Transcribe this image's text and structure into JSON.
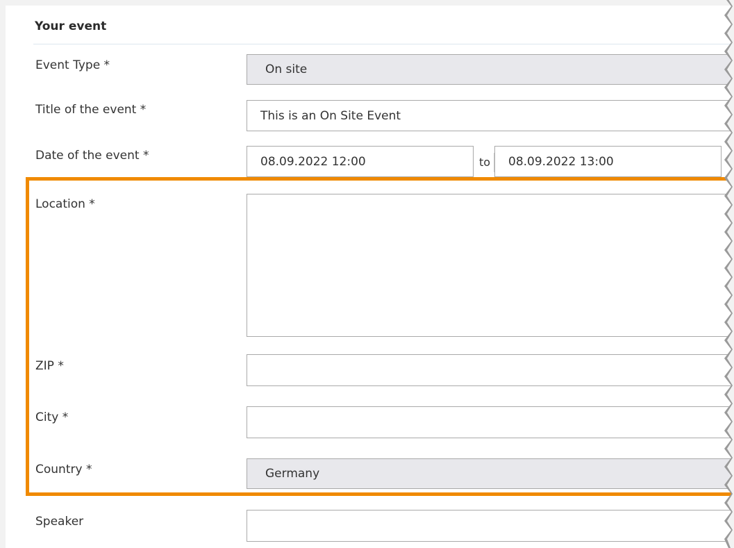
{
  "section": {
    "title": "Your event"
  },
  "form": {
    "event_type": {
      "label": "Event Type *",
      "value": "On site"
    },
    "title": {
      "label": "Title of the event *",
      "value": "This is an On Site Event"
    },
    "date": {
      "label": "Date of the event *",
      "start": "08.09.2022 12:00",
      "separator": "to",
      "end": "08.09.2022 13:00"
    },
    "location": {
      "label": "Location *",
      "value": ""
    },
    "zip": {
      "label": "ZIP *",
      "value": ""
    },
    "city": {
      "label": "City *",
      "value": ""
    },
    "country": {
      "label": "Country *",
      "value": "Germany"
    },
    "speaker": {
      "label": "Speaker",
      "value": ""
    }
  },
  "highlight": {
    "color": "#f08a00"
  },
  "colors": {
    "page_bg": "#f2f2f2",
    "field_border": "#a9a9a9",
    "select_bg": "#e8e8ec"
  }
}
